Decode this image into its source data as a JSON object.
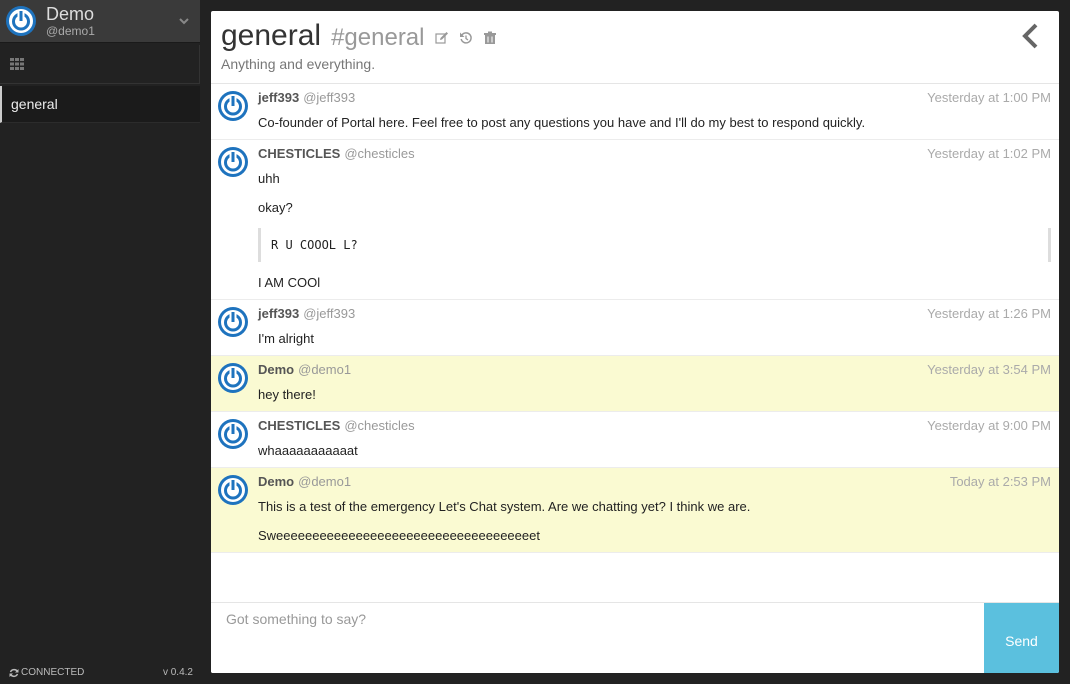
{
  "colors": {
    "accent": "#1e73be",
    "send": "#5bc0de",
    "self_highlight": "#fafad2"
  },
  "user": {
    "name": "Demo",
    "handle": "@demo1"
  },
  "sidebar": {
    "rooms": [
      {
        "label": "general"
      }
    ]
  },
  "status": {
    "connection": "CONNECTED",
    "version": "v 0.4.2"
  },
  "room": {
    "name": "general",
    "slug": "#general",
    "description": "Anything and everything."
  },
  "messages": [
    {
      "name": "jeff393",
      "handle": "@jeff393",
      "time": "Yesterday at 1:00 PM",
      "self": false,
      "lines": [
        "Co-founder of Portal here. Feel free to post any questions you have and I'll do my best to respond quickly."
      ]
    },
    {
      "name": "CHESTICLES",
      "handle": "@chesticles",
      "time": "Yesterday at 1:02 PM",
      "self": false,
      "lines": [
        "uhh",
        "okay?"
      ],
      "code": "R U COOOL L?",
      "after": [
        "I AM COOl"
      ]
    },
    {
      "name": "jeff393",
      "handle": "@jeff393",
      "time": "Yesterday at 1:26 PM",
      "self": false,
      "lines": [
        "I'm alright"
      ]
    },
    {
      "name": "Demo",
      "handle": "@demo1",
      "time": "Yesterday at 3:54 PM",
      "self": true,
      "lines": [
        "hey there!"
      ]
    },
    {
      "name": "CHESTICLES",
      "handle": "@chesticles",
      "time": "Yesterday at 9:00 PM",
      "self": false,
      "lines": [
        "whaaaaaaaaaaat"
      ]
    },
    {
      "name": "Demo",
      "handle": "@demo1",
      "time": "Today at 2:53 PM",
      "self": true,
      "lines": [
        "This is a test of the emergency Let's Chat system. Are we chatting yet? I think we are.",
        "Sweeeeeeeeeeeeeeeeeeeeeeeeeeeeeeeeeeeet"
      ]
    }
  ],
  "composer": {
    "placeholder": "Got something to say?",
    "send_label": "Send"
  },
  "icons": {
    "avatar": "power-avatar-icon",
    "apps": "grid-icon",
    "edit": "edit-icon",
    "history": "history-icon",
    "archive": "archive-icon",
    "back": "chevron-left-icon",
    "refresh": "refresh-icon"
  }
}
